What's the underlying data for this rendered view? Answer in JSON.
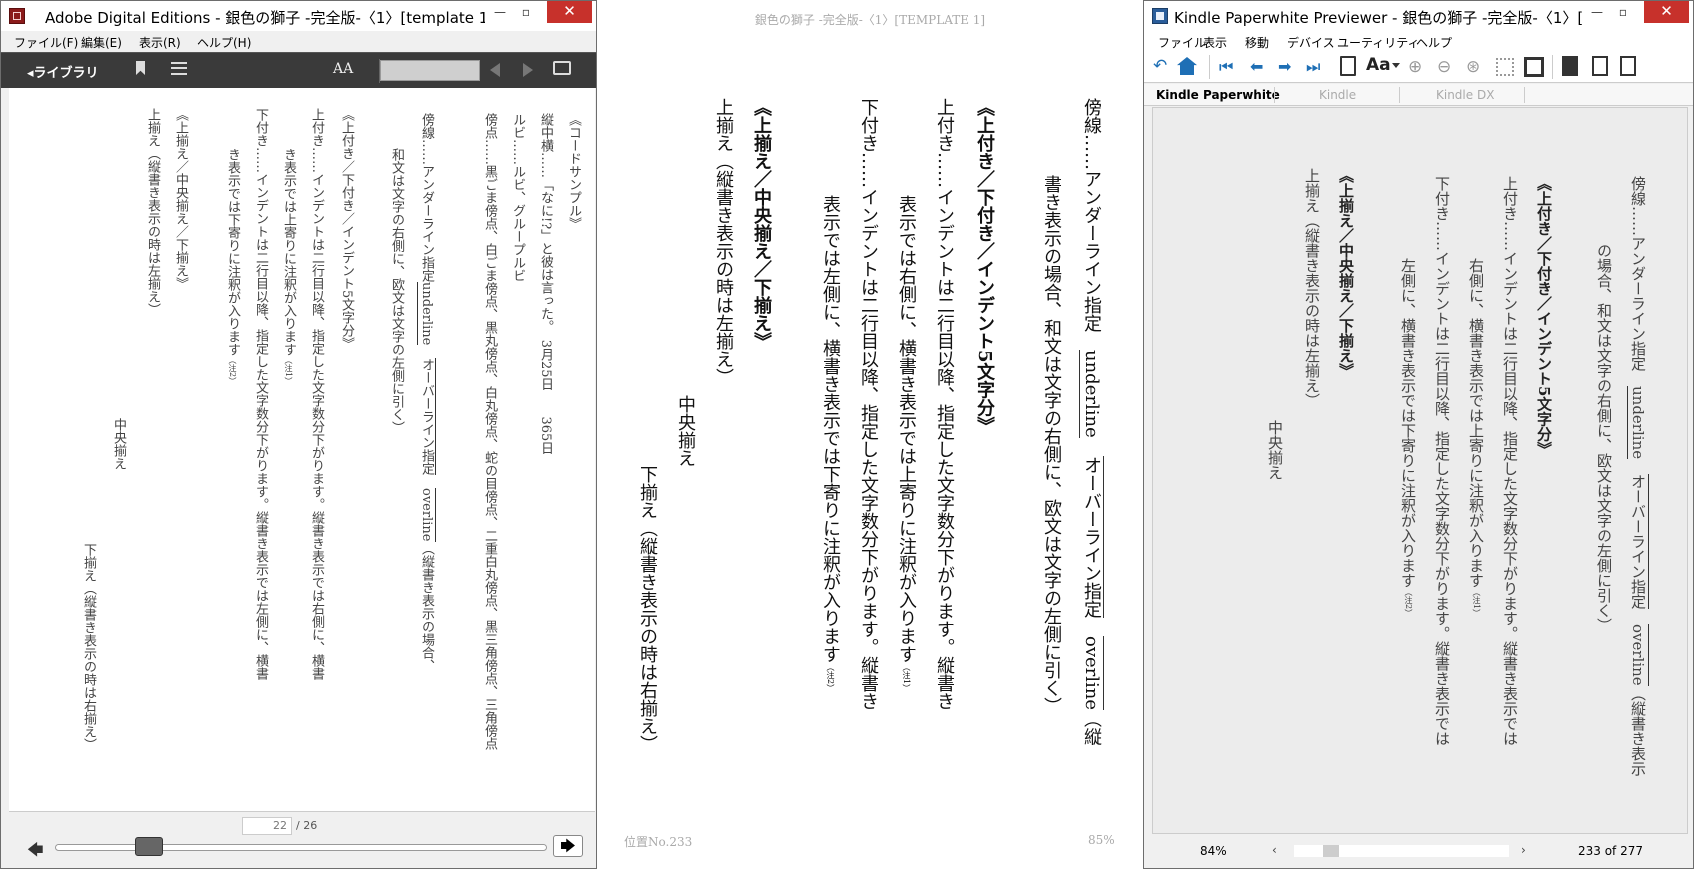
{
  "ade": {
    "title": "Adobe Digital Editions - 銀色の獅子 -完全版-〈1〉[template 1]",
    "menus": [
      "ファイル(F)",
      "編集(E)",
      "表示(R)",
      "ヘルプ(H)"
    ],
    "library_label": "◂ライブラリ",
    "font_size_label": "AA",
    "page_current": "22",
    "page_total": "/ 26",
    "columns": [
      "《コードサンプル》",
      "縦中横……「なに!?」と彼は言った。　3月25日　　365日",
      "ルビ……ルビ、グループルビ",
      "傍点……黒ごま傍点、白ごま傍点、黒丸傍点、白丸傍点、蛇の目傍点、二重白丸傍点、黒三角傍点、三角傍点",
      "傍線……アンダーライン指定",
      "underline",
      "和文は文字の右側に、欧文は文字の左側に引く）",
      "オーバーライン指定",
      "overline",
      "（縦書き表示の場合、",
      "《上付き／下付き／インデント5文字分》",
      "上付き……インデントは二行目以降、指定した文字数分下がります。縦書き表示では右側に、横書",
      "き表示では上寄りに注釈が入ります",
      "（注1）",
      "下付き……インデントは二行目以降、指定した文字数分下がります。縦書き表示では左側に、横書",
      "き表示では下寄りに注釈が入ります",
      "（注2）",
      "《上揃え／中央揃え／下揃え》",
      "上揃え（縦書き表示の時は左揃え）",
      "中央揃え",
      "下揃え（縦書き表示の時は右揃え）"
    ]
  },
  "middle": {
    "header": "銀色の獅子 -完全版-〈1〉[TEMPLATE 1]",
    "footer_left": "位置No.233",
    "footer_right": "85%",
    "columns": [
      "傍線……アンダーライン指定",
      "underline",
      "オーバーライン指定",
      "overline",
      "（縦",
      "書き表示の場合、和文は文字の右側に、欧文は文字の左側に引く）",
      "《上付き／下付き／インデント5文字分》",
      "上付き……インデントは二行目以降、指定した文字数分下がります。縦書き",
      "表示では右側に、横書き表示では上寄りに注釈が入ります",
      "（注1）",
      "下付き……インデントは二行目以降、指定した文字数分下がります。縦書き",
      "表示では左側に、横書き表示では下寄りに注釈が入ります",
      "（注2）",
      "《上揃え／中央揃え／下揃え》",
      "上揃え（縦書き表示の時は左揃え）",
      "中央揃え",
      "下揃え（縦書き表示の時は右揃え）"
    ]
  },
  "kpp": {
    "title": "Kindle Paperwhite Previewer - 銀色の獅子 -完全版-〈1〉[...",
    "menus": [
      "ファイル",
      "表示",
      "移動",
      "デバイス",
      "ユーティリティ",
      "ヘルプ"
    ],
    "font_label": "Aa",
    "device_tabs": [
      "Kindle Paperwhite",
      "Kindle",
      "Kindle DX"
    ],
    "zoom": "84%",
    "position": "233 of 277",
    "columns": [
      "傍線……アンダーライン指定",
      "underline",
      "オーバーライン指定",
      "overline",
      "（縦書き表示",
      "の場合、和文は文字の右側に、欧文は文字の左側に引く）",
      "《上付き／下付き／インデント5文字分》",
      "上付き……インデントは二行目以降、指定した文字数分下がります。縦書き表示では",
      "右側に、横書き表示では上寄りに注釈が入ります",
      "（注1）",
      "下付き……インデントは二行目以降、指定した文字数分下がります。縦書き表示では",
      "左側に、横書き表示では下寄りに注釈が入ります",
      "（注2）",
      "《上揃え／中央揃え／下揃え》",
      "上揃え（縦書き表示の時は左揃え）",
      "中央揃え"
    ]
  },
  "colors": {
    "ade_toolbar": "#3a3a3a",
    "close_button": "#c7312b",
    "link_blue": "#1e6fb5"
  }
}
